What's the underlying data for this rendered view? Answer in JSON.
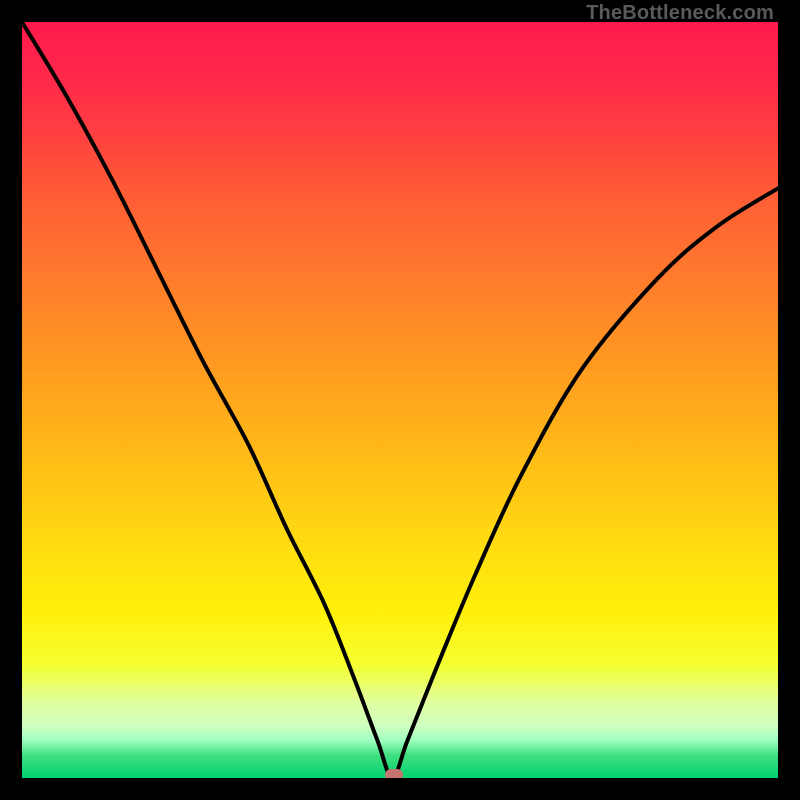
{
  "watermark": "TheBottleneck.com",
  "colors": {
    "frame": "#000000",
    "curve": "#000000",
    "marker": "#c77570"
  },
  "chart_data": {
    "type": "line",
    "title": "",
    "xlabel": "",
    "ylabel": "",
    "x_range": [
      0,
      100
    ],
    "y_range": [
      0,
      100
    ],
    "note": "Axes are unitless percent across plot area; curve drops from top-left, reaches minimum near x=49 then rises toward right. Values estimated from pixel positions.",
    "series": [
      {
        "name": "bottleneck-curve",
        "x": [
          0,
          6,
          12,
          18,
          24,
          30,
          35,
          40,
          44,
          47,
          49,
          51,
          55,
          60,
          66,
          74,
          84,
          92,
          100
        ],
        "y": [
          100,
          90,
          79,
          67,
          55,
          44,
          33,
          23,
          13,
          5,
          0,
          5,
          15,
          27,
          40,
          54,
          66,
          73,
          78
        ]
      }
    ],
    "marker": {
      "x": 49.2,
      "y": 0
    },
    "background_gradient": {
      "top": "#ff1a4d",
      "mid": "#ffde10",
      "bottom": "#00d070"
    }
  }
}
